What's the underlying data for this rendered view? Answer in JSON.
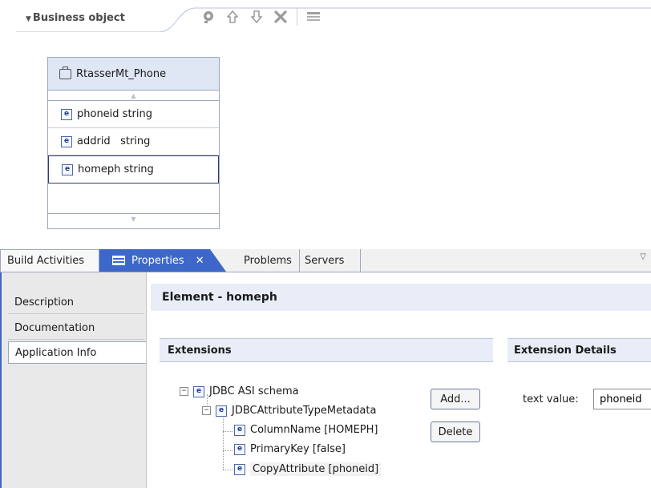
{
  "editor": {
    "section_title": "Business object",
    "toolbar": [
      "add-attribute-icon",
      "move-up-icon",
      "move-down-icon",
      "delete-icon",
      "properties-icon"
    ]
  },
  "business_object": {
    "name": "RtasserMt_Phone",
    "attributes": [
      {
        "label": "phoneid string",
        "selected": false
      },
      {
        "label": "addrid   string",
        "selected": false
      },
      {
        "label": "homeph string",
        "selected": true
      }
    ]
  },
  "tabs": {
    "build": "Build Activities",
    "properties": "Properties",
    "properties_close": "✕",
    "problems": "Problems",
    "servers": "Servers"
  },
  "properties": {
    "side_tabs": [
      "Description",
      "Documentation",
      "Application Info"
    ],
    "active_side_tab": "Application Info",
    "header": "Element - homeph",
    "extensions_title": "Extensions",
    "details_title": "Extension Details",
    "tree": {
      "root": "JDBC ASI schema",
      "meta": "JDBCAttributeTypeMetadata",
      "children": [
        "ColumnName [HOMEPH]",
        "PrimaryKey [false]",
        "CopyAttribute [phoneid]"
      ]
    },
    "add_button": "Add...",
    "delete_button": "Delete",
    "text_value_label": "text value:",
    "text_value": "phoneid"
  },
  "colors": {
    "active_tab": "#3d67c8",
    "header_bg": "#e8edf7",
    "element_icon": "#1e3c8b"
  }
}
